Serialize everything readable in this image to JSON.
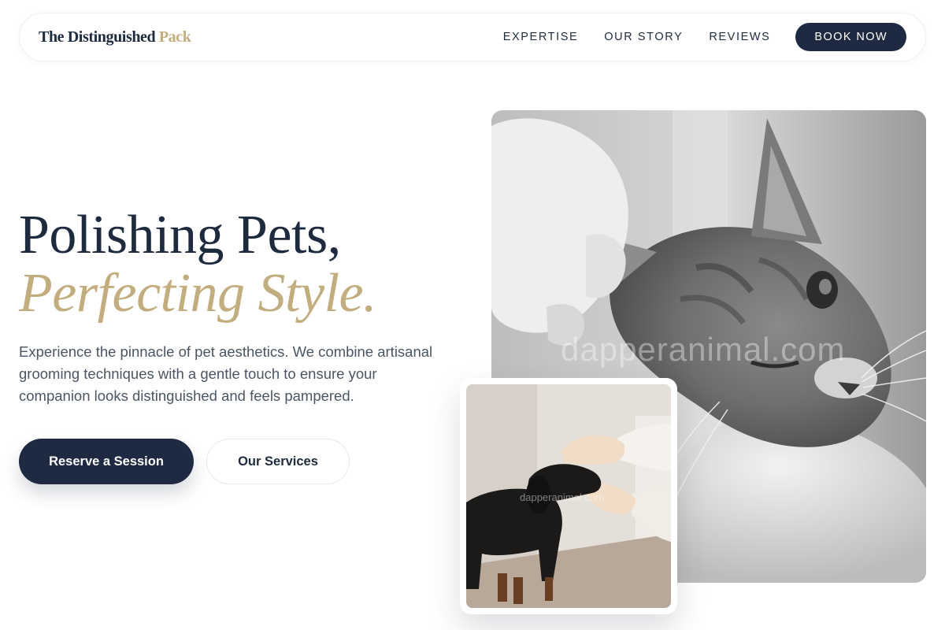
{
  "brand": {
    "name_main": "The Distinguished",
    "name_accent": "Pack",
    "accent_color": "#c2ad7e",
    "primary_color": "#1e2a42"
  },
  "nav": {
    "links": [
      {
        "label": "EXPERTISE"
      },
      {
        "label": "OUR STORY"
      },
      {
        "label": "REVIEWS"
      }
    ],
    "cta_label": "BOOK NOW"
  },
  "hero": {
    "headline_line1": "Polishing Pets,",
    "headline_line2": "Perfecting Style.",
    "lead": "Experience the pinnacle of pet aesthetics. We combine artisanal grooming techniques with a gentle touch to ensure your companion looks distinguished and feels pampered.",
    "primary_cta": "Reserve a Session",
    "secondary_cta": "Our Services"
  },
  "images": {
    "main_watermark": "dapperanimal.com",
    "card_watermark": "dapperanimal.com"
  }
}
